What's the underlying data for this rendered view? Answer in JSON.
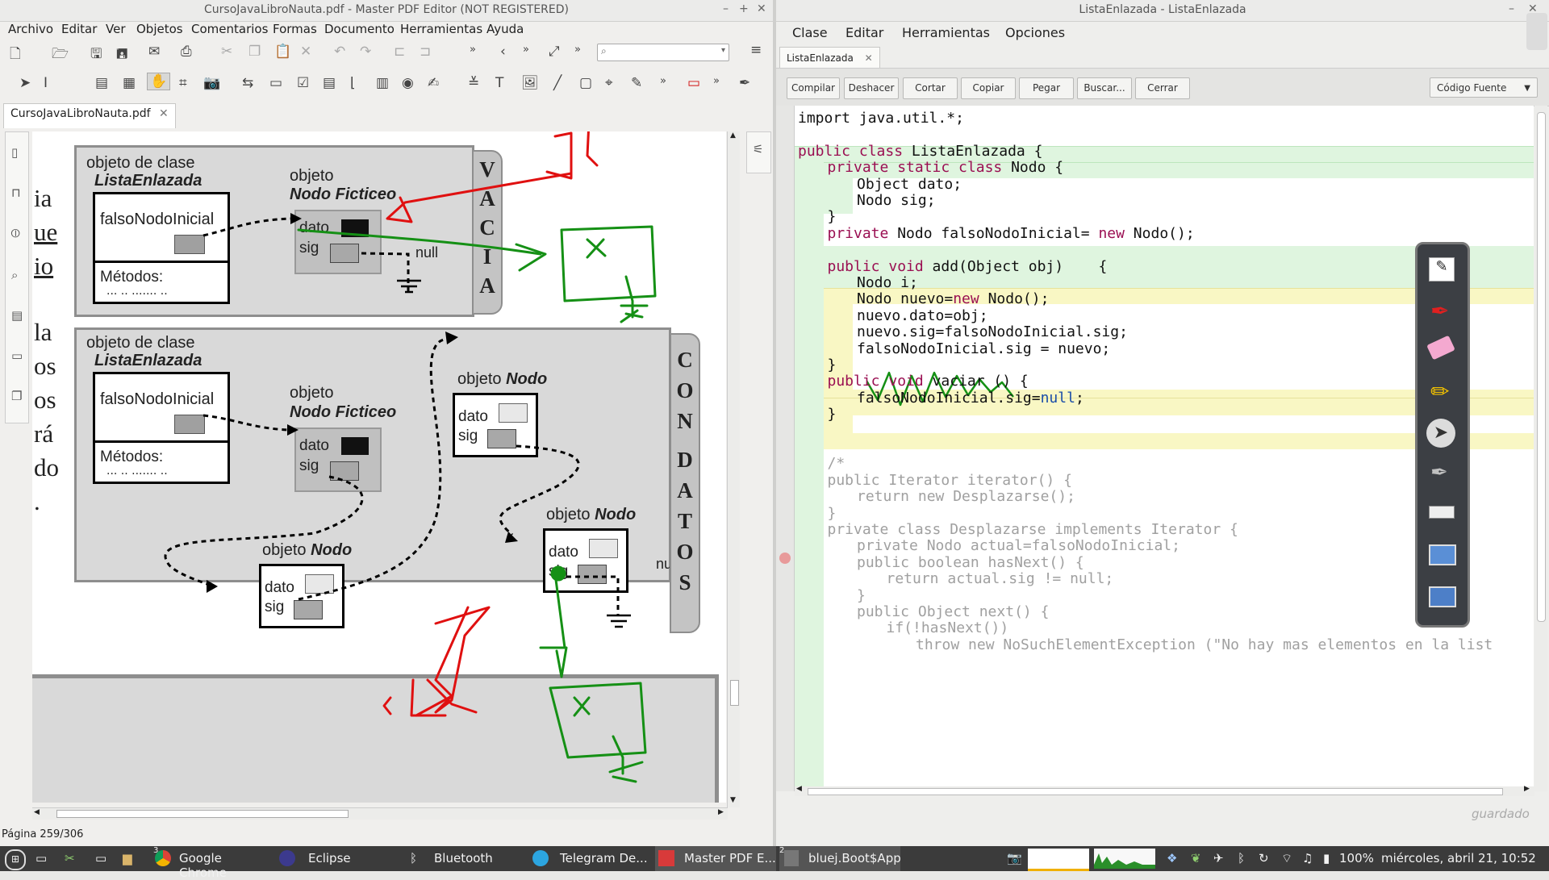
{
  "pdf": {
    "title": "CursoJavaLibroNauta.pdf - Master PDF Editor (NOT REGISTERED)",
    "menu": [
      "Archivo",
      "Editar",
      "Ver",
      "Objetos",
      "Comentarios",
      "Formas",
      "Documento",
      "Herramientas",
      "Ayuda"
    ],
    "tab": "CursoJavaLibroNauta.pdf",
    "status": "Página 259/306",
    "left_text": [
      "ia",
      "ue",
      "io",
      "la",
      "os",
      "os",
      "rá",
      "do",
      "."
    ],
    "box1": {
      "title1": "objeto de clase",
      "title2": "ListaEnlazada",
      "field": "falsoNodoInicial",
      "methods": "Métodos:",
      "dots": "... .. ....... ..",
      "node_title1": "objeto",
      "node_title2": "Nodo Ficticeo",
      "dato": "dato",
      "sig": "sig",
      "null": "null",
      "vert": [
        "V",
        "A",
        "C",
        "I",
        "A"
      ]
    },
    "box2": {
      "title1": "objeto de clase",
      "title2": "ListaEnlazada",
      "field": "falsoNodoInicial",
      "methods": "Métodos:",
      "dots": "... .. ....... ..",
      "node_title1": "objeto",
      "node_title2": "Nodo Ficticeo",
      "obj_prefix": "objeto",
      "obj_nodo": "Nodo",
      "dato": "dato",
      "sig": "sig",
      "null": "null",
      "vert": [
        "C",
        "O",
        "N",
        "D",
        "A",
        "T",
        "O",
        "S"
      ]
    }
  },
  "bluej": {
    "title": "ListaEnlazada - ListaEnlazada",
    "menu": [
      "Clase",
      "Editar",
      "Herramientas",
      "Opciones"
    ],
    "tab": "ListaEnlazada",
    "buttons": [
      "Compilar",
      "Deshacer",
      "Cortar",
      "Copiar",
      "Pegar",
      "Buscar...",
      "Cerrar"
    ],
    "view_select": "Código Fuente",
    "status": "guardado",
    "code": [
      {
        "t": "import java.util.*;",
        "i": 0
      },
      {
        "t": "",
        "i": 0
      },
      {
        "k": "public class",
        "t": " ListaEnlazada {",
        "i": 0
      },
      {
        "k": "private static class",
        "t": " Nodo {",
        "i": 1
      },
      {
        "t": "Object dato;",
        "i": 2
      },
      {
        "t": "Nodo sig;",
        "i": 2
      },
      {
        "t": "}",
        "i": 1
      },
      {
        "k": "private",
        "t": " Nodo falsoNodoInicial= ",
        "k2": "new",
        "t2": " Nodo();",
        "i": 1
      },
      {
        "t": "",
        "i": 0
      },
      {
        "k": "public void",
        "t": " add(Object obj)    {",
        "i": 1
      },
      {
        "t": "Nodo i;",
        "i": 2
      },
      {
        "t": "Nodo nuevo=",
        "k2": "new",
        "t2": " Nodo();",
        "i": 2
      },
      {
        "t": "nuevo.dato=obj;",
        "i": 2
      },
      {
        "t": "nuevo.sig=falsoNodoInicial.sig;",
        "i": 2
      },
      {
        "t": "falsoNodoInicial.sig = nuevo;",
        "i": 2
      },
      {
        "t": "}",
        "i": 1
      },
      {
        "k": "public void",
        "t": " vaciar () {",
        "i": 1
      },
      {
        "t": "falsoNodoInicial.sig=",
        "n": "null",
        "t2": ";",
        "i": 2
      },
      {
        "t": "}",
        "i": 1
      },
      {
        "t": "",
        "i": 0
      },
      {
        "t": "",
        "i": 0
      },
      {
        "c": "/*",
        "i": 1
      },
      {
        "c": "public Iterator iterator() {",
        "i": 1
      },
      {
        "c": "return new Desplazarse();",
        "i": 2
      },
      {
        "c": "}",
        "i": 1
      },
      {
        "c": "private class Desplazarse implements Iterator {",
        "i": 1
      },
      {
        "c": "private Nodo actual=falsoNodoInicial;",
        "i": 2
      },
      {
        "c": "public boolean hasNext() {",
        "i": 2
      },
      {
        "c": "return actual.sig != null;",
        "i": 3
      },
      {
        "c": "}",
        "i": 2
      },
      {
        "c": "public Object next() {",
        "i": 2
      },
      {
        "c": "if(!hasNext())",
        "i": 3
      },
      {
        "c": "throw new NoSuchElementException (\"No hay mas elementos en la list",
        "i": 4
      }
    ]
  },
  "taskbar": {
    "items": [
      {
        "label": "Google Chrome",
        "badge": "3"
      },
      {
        "label": "Eclipse"
      },
      {
        "label": "Bluetooth"
      },
      {
        "label": "Telegram De..."
      },
      {
        "label": "Master PDF E..."
      },
      {
        "label": "bluej.Boot$App",
        "badge": "2"
      }
    ],
    "battery": "100%",
    "clock": "miércoles, abril 21, 10:52"
  },
  "colors": {
    "kw": "#9a0f52",
    "comment": "#a0a0a0",
    "ink_red": "#e01010",
    "ink_green": "#159015",
    "scope_green": "#dff5df",
    "scope_yellow": "#f9f7c4"
  }
}
